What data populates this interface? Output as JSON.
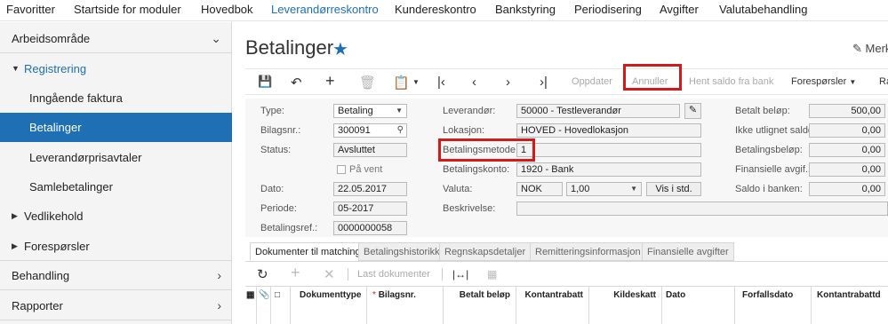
{
  "topnav": {
    "items": [
      "Favoritter",
      "Startside for moduler",
      "Hovedbok",
      "Leverandørreskontro",
      "Kundereskontro",
      "Bankstyring",
      "Periodisering",
      "Avgifter",
      "Valutabehandling"
    ]
  },
  "sidebar": {
    "workspace": "Arbeidsområde",
    "registrering": "Registrering",
    "sub": [
      "Inngående faktura",
      "Betalinger",
      "Leverandørprisavtaler",
      "Samlebetalinger"
    ],
    "vedlikehold": "Vedlikehold",
    "foresporsler": "Forespørsler",
    "behandling": "Behandling",
    "rapporter": "Rapporter"
  },
  "page": {
    "title": "Betalinger",
    "merk": "Merk"
  },
  "toolbar": {
    "oppdater": "Oppdater",
    "annuller": "Annuller",
    "hent_saldo": "Hent saldo fra bank",
    "foresporsler": "Forespørsler",
    "more": "Ra"
  },
  "form": {
    "type_label": "Type:",
    "type_value": "Betaling",
    "bilagsnr_label": "Bilagsnr.:",
    "bilagsnr_value": "300091",
    "status_label": "Status:",
    "status_value": "Avsluttet",
    "pa_vent": "På vent",
    "dato_label": "Dato:",
    "dato_value": "22.05.2017",
    "periode_label": "Periode:",
    "periode_value": "05-2017",
    "betref_label": "Betalingsref.:",
    "betref_value": "0000000058",
    "leverandor_label": "Leverandør:",
    "leverandor_value": "50000 - Testleverandør",
    "lokasjon_label": "Lokasjon:",
    "lokasjon_value": "HOVED - Hovedlokasjon",
    "betmetode_label": "Betalingsmetode:",
    "betmetode_value": "1",
    "betkonto_label": "Betalingskonto:",
    "betkonto_value": "1920 - Bank",
    "valuta_label": "Valuta:",
    "valuta_value": "NOK",
    "kurs_value": "1,00",
    "vis_std": "Vis i std.",
    "beskrivelse_label": "Beskrivelse:",
    "betalt_belop_label": "Betalt beløp:",
    "betalt_belop_value": "500,00",
    "ikke_utlignet_label": "Ikke utlignet saldo:",
    "ikke_utlignet_value": "0,00",
    "betalingsbelop_label": "Betalingsbeløp:",
    "betalingsbelop_value": "0,00",
    "finansielle_label": "Finansielle avgif...",
    "finansielle_value": "0,00",
    "saldo_label": "Saldo i banken:",
    "saldo_value": "0,00"
  },
  "tabs": [
    "Dokumenter til matching",
    "Betalingshistorikk",
    "Regnskapsdetaljer",
    "Remitteringsinformasjon",
    "Finansielle avgifter"
  ],
  "gridtoolbar": {
    "last_dokumenter": "Last dokumenter"
  },
  "grid": {
    "columns": [
      "Dokumenttype",
      "Bilagsnr.",
      "Betalt beløp",
      "Kontantrabatt",
      "Kildeskatt",
      "Dato",
      "Forfallsdato",
      "Kontantrabattd"
    ],
    "required_mark": "*"
  },
  "colors": {
    "accent": "#1f6fb5",
    "highlight": "#d11a1a"
  }
}
